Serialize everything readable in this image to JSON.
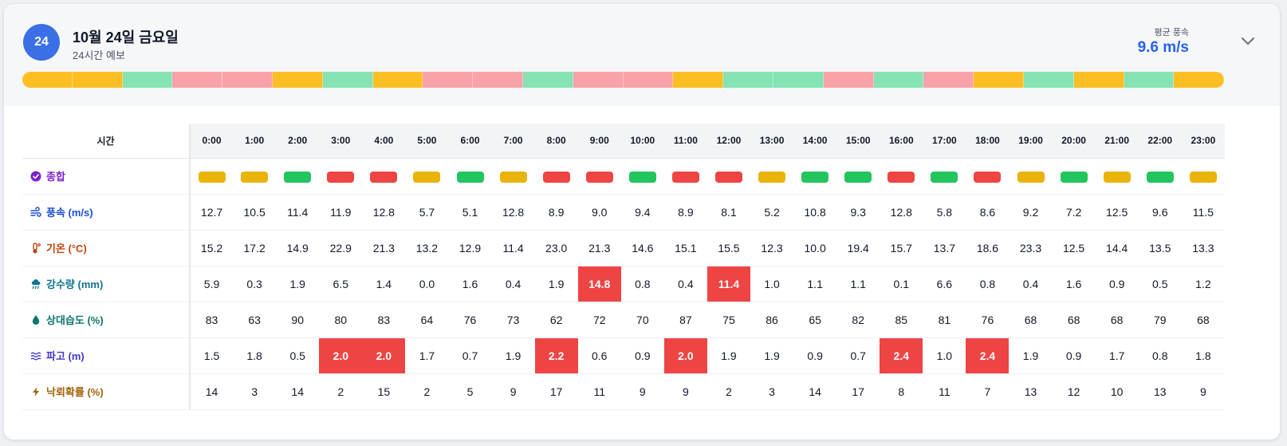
{
  "header": {
    "day_badge": "24",
    "title": "10월 24일 금요일",
    "subtitle": "24시간 예보",
    "avg_label": "평균 풍속",
    "avg_value": "9.6 m/s"
  },
  "colors": {
    "yellow": "#fbbf24",
    "green": "#86e3b4",
    "red": "#f8a3a8",
    "pill_yellow": "#eab308",
    "pill_green": "#22c55e",
    "pill_red": "#ef4444",
    "highlight": "#ef4444",
    "accent": "#2563eb"
  },
  "status_strip": [
    "yellow",
    "yellow",
    "green",
    "red",
    "red",
    "yellow",
    "green",
    "yellow",
    "red",
    "red",
    "green",
    "red",
    "red",
    "yellow",
    "green",
    "green",
    "red",
    "green",
    "red",
    "yellow",
    "green",
    "yellow",
    "green",
    "yellow"
  ],
  "table": {
    "time_header": "시간",
    "hours": [
      "0:00",
      "1:00",
      "2:00",
      "3:00",
      "4:00",
      "5:00",
      "6:00",
      "7:00",
      "8:00",
      "9:00",
      "10:00",
      "11:00",
      "12:00",
      "13:00",
      "14:00",
      "15:00",
      "16:00",
      "17:00",
      "18:00",
      "19:00",
      "20:00",
      "21:00",
      "22:00",
      "23:00"
    ],
    "rows": [
      {
        "label": "종합",
        "icon": "check-circle-icon",
        "color": "#7e22ce",
        "type": "pills",
        "values": [
          "yellow",
          "yellow",
          "green",
          "red",
          "red",
          "yellow",
          "green",
          "yellow",
          "red",
          "red",
          "green",
          "red",
          "red",
          "yellow",
          "green",
          "green",
          "red",
          "green",
          "red",
          "yellow",
          "green",
          "yellow",
          "green",
          "yellow"
        ]
      },
      {
        "label": "풍속 (m/s)",
        "icon": "wind-icon",
        "color": "#1d4ed8",
        "type": "values",
        "values": [
          "12.7",
          "10.5",
          "11.4",
          "11.9",
          "12.8",
          "5.7",
          "5.1",
          "12.8",
          "8.9",
          "9.0",
          "9.4",
          "8.9",
          "8.1",
          "5.2",
          "10.8",
          "9.3",
          "12.8",
          "5.8",
          "8.6",
          "9.2",
          "7.2",
          "12.5",
          "9.6",
          "11.5"
        ],
        "highlight": []
      },
      {
        "label": "기온 (°C)",
        "icon": "thermometer-icon",
        "color": "#c2410c",
        "type": "values",
        "values": [
          "15.2",
          "17.2",
          "14.9",
          "22.9",
          "21.3",
          "13.2",
          "12.9",
          "11.4",
          "23.0",
          "21.3",
          "14.6",
          "15.1",
          "15.5",
          "12.3",
          "10.0",
          "19.4",
          "15.7",
          "13.7",
          "18.6",
          "23.3",
          "12.5",
          "14.4",
          "13.5",
          "13.3"
        ],
        "highlight": []
      },
      {
        "label": "강수량 (mm)",
        "icon": "rain-cloud-icon",
        "color": "#0e7490",
        "type": "values",
        "values": [
          "5.9",
          "0.3",
          "1.9",
          "6.5",
          "1.4",
          "0.0",
          "1.6",
          "0.4",
          "1.9",
          "14.8",
          "0.8",
          "0.4",
          "11.4",
          "1.0",
          "1.1",
          "1.1",
          "0.1",
          "6.6",
          "0.8",
          "0.4",
          "1.6",
          "0.9",
          "0.5",
          "1.2"
        ],
        "highlight": [
          9,
          12
        ]
      },
      {
        "label": "상대습도 (%)",
        "icon": "droplet-icon",
        "color": "#0f766e",
        "type": "values",
        "values": [
          "83",
          "63",
          "90",
          "80",
          "83",
          "64",
          "76",
          "73",
          "62",
          "72",
          "70",
          "87",
          "75",
          "86",
          "65",
          "82",
          "85",
          "81",
          "76",
          "68",
          "68",
          "68",
          "79",
          "68"
        ],
        "highlight": []
      },
      {
        "label": "파고 (m)",
        "icon": "waves-icon",
        "color": "#4338ca",
        "type": "values",
        "values": [
          "1.5",
          "1.8",
          "0.5",
          "2.0",
          "2.0",
          "1.7",
          "0.7",
          "1.9",
          "2.2",
          "0.6",
          "0.9",
          "2.0",
          "1.9",
          "1.9",
          "0.9",
          "0.7",
          "2.4",
          "1.0",
          "2.4",
          "1.9",
          "0.9",
          "1.7",
          "0.8",
          "1.8"
        ],
        "highlight": [
          3,
          4,
          8,
          11,
          16,
          18
        ]
      },
      {
        "label": "낙뢰확률 (%)",
        "icon": "lightning-icon",
        "color": "#a16207",
        "type": "values",
        "values": [
          "14",
          "3",
          "14",
          "2",
          "15",
          "2",
          "5",
          "9",
          "17",
          "11",
          "9",
          "9",
          "2",
          "3",
          "14",
          "17",
          "8",
          "11",
          "7",
          "13",
          "12",
          "10",
          "13",
          "9"
        ],
        "highlight": []
      }
    ]
  }
}
